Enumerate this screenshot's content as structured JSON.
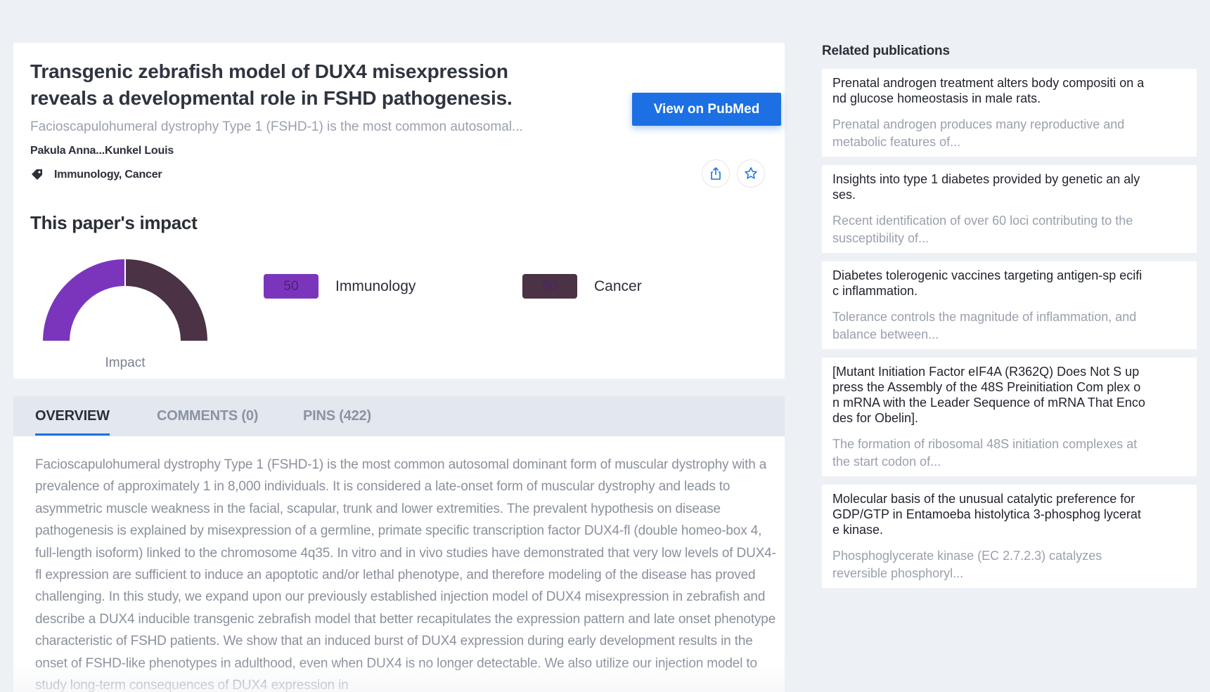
{
  "paper": {
    "title": "Transgenic zebrafish model of DUX4 misexpression reveals a developmental role in FSHD pathogenesis.",
    "abstract_snippet": "Facioscapulohumeral dystrophy Type 1 (FSHD-1) is the most common autosomal...",
    "authors": "Pakula Anna...Kunkel Louis",
    "tags": "Immunology, Cancer",
    "pubmed_button_label": "View on PubMed",
    "icons": {
      "tag": "tag-icon",
      "share": "share-icon",
      "star": "star-icon"
    }
  },
  "impact": {
    "title": "This paper's impact",
    "gauge_label": "Impact",
    "segments": [
      {
        "name": "Immunology",
        "value": 50,
        "color": "#7b35bd"
      },
      {
        "name": "Cancer",
        "value": 50,
        "color": "#4b3245"
      }
    ]
  },
  "tabs": [
    {
      "label": "OVERVIEW",
      "active": true
    },
    {
      "label": "COMMENTS (0)",
      "active": false
    },
    {
      "label": "PINS (422)",
      "active": false
    }
  ],
  "overview_text": "Facioscapulohumeral dystrophy Type 1 (FSHD-1) is the most common autosomal dominant form of muscular dystrophy with a prevalence of approximately 1 in 8,000 individuals. It is considered a late-onset form of muscular dystrophy and leads to asymmetric muscle weakness in the facial, scapular, trunk and lower extremities. The prevalent hypothesis on disease pathogenesis is explained by misexpression of a germline, primate specific transcription factor DUX4-fl (double homeo-box 4, full-length isoform) linked to the chromosome 4q35. In vitro and in vivo studies have demonstrated that very low levels of DUX4-fl expression are sufficient to induce an apoptotic and/or lethal phenotype, and therefore modeling of the disease has proved challenging. In this study, we expand upon our previously established injection model of DUX4 misexpression in zebrafish and describe a DUX4 inducible transgenic zebrafish model that better recapitulates the expression pattern and late onset phenotype characteristic of FSHD patients. We show that an induced burst of DUX4 expression during early development results in the onset of FSHD-like phenotypes in adulthood, even when DUX4 is no longer detectable. We also utilize our injection model to study long-term consequences of DUX4 expression in",
  "related": {
    "title": "Related publications",
    "items": [
      {
        "title": "Prenatal androgen treatment alters body compositi on and glucose homeostasis in male rats.",
        "snippet": "Prenatal androgen produces many reproductive and metabolic features of..."
      },
      {
        "title": "Insights into type 1 diabetes provided by genetic an alyses.",
        "snippet": "Recent identification of over 60 loci contributing to the susceptibility of..."
      },
      {
        "title": "Diabetes tolerogenic vaccines targeting antigen-sp ecific inflammation.",
        "snippet": "Tolerance controls the magnitude of inflammation, and balance between..."
      },
      {
        "title": "[Mutant Initiation Factor eIF4A (R362Q) Does Not S uppress the Assembly of the 48S Preinitiation Com plex on mRNA with the Leader Sequence of mRNA That Encodes for Obelin].",
        "snippet": "The formation of ribosomal 48S initiation complexes at the start codon of..."
      },
      {
        "title": "Molecular basis of the unusual catalytic preference for GDP/GTP in Entamoeba histolytica 3-phosphog lycerate kinase.",
        "snippet": "Phosphoglycerate kinase (EC 2.7.2.3) catalyzes reversible phosphoryl..."
      }
    ]
  }
}
